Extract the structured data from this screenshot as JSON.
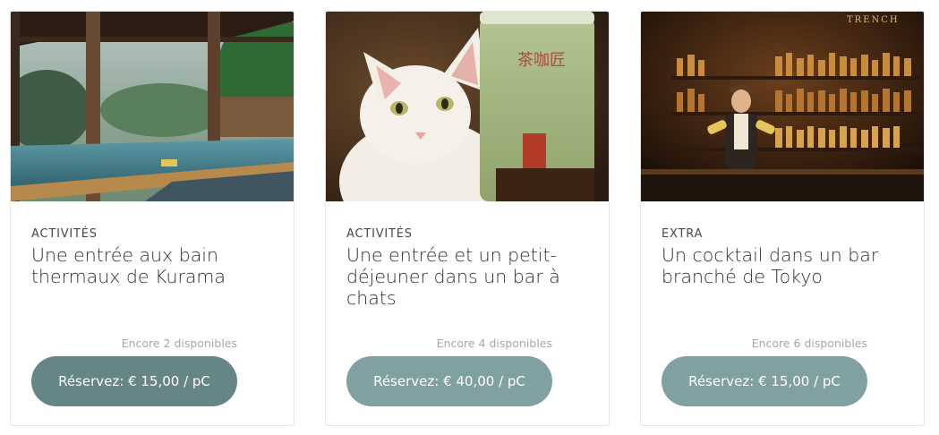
{
  "cards": [
    {
      "image_subject": "outdoor hot spring bath under wooden roof",
      "category": "ACTIVITÉS",
      "title": "Une entrée aux bain thermaux de Kurama",
      "availability": "Encore 2 disponibles",
      "button_label": "Réservez: € 15,00 / pC"
    },
    {
      "image_subject": "white cat next to bubble tea cup",
      "cup_text": "茶咖匠",
      "category": "ACTIVITÉS",
      "title": "Une entrée et un petit-déjeuner dans un bar à chats",
      "availability": "Encore 4 disponibles",
      "button_label": "Réservez: € 40,00 / pC"
    },
    {
      "image_subject": "bartender in front of shelves of bottles",
      "sign_text": "TRENCH",
      "category": "EXTRA",
      "title": "Un cocktail dans un bar branché de Tokyo",
      "availability": "Encore 6 disponibles",
      "button_label": "Réservez: € 15,00 / pC"
    }
  ],
  "colors": {
    "button_active": "#668586",
    "button": "#80a0a1",
    "card_border": "#e4e6e6"
  }
}
